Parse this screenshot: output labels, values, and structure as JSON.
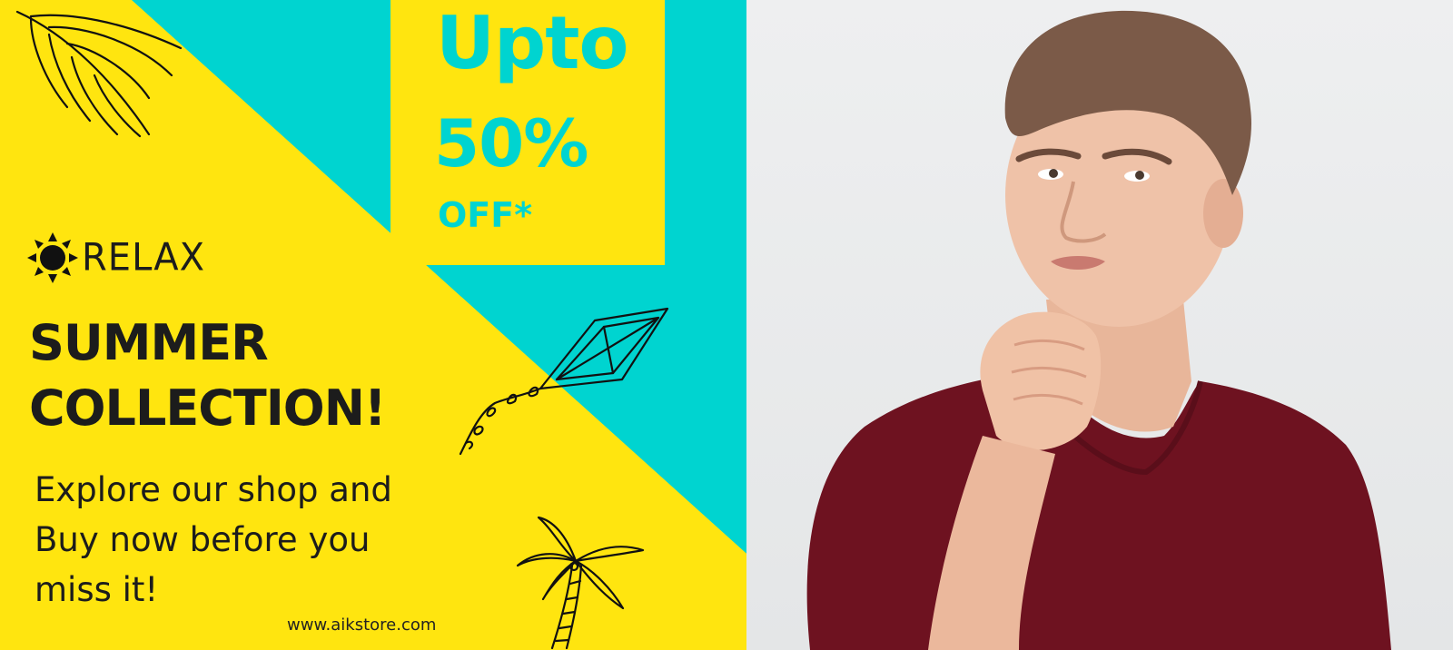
{
  "offer": {
    "line1": "Upto",
    "line2": "50%",
    "line3": "OFF*"
  },
  "brand": {
    "icon": "sun-icon",
    "label": "RELAX"
  },
  "headline": {
    "line1": "SUMMER",
    "line2": "COLLECTION!"
  },
  "tagline": {
    "line1": "Explore our shop and",
    "line2": "Buy now before you",
    "line3": "miss it!"
  },
  "website": "www.aikstore.com",
  "colors": {
    "teal": "#00D4D0",
    "yellow": "#FFE50F",
    "text": "#1c1c1c",
    "shirt": "#6e1220"
  },
  "decorations": [
    "palm-leaf-icon",
    "kite-icon",
    "palm-tree-icon"
  ],
  "photo": "man-thinking-photo"
}
